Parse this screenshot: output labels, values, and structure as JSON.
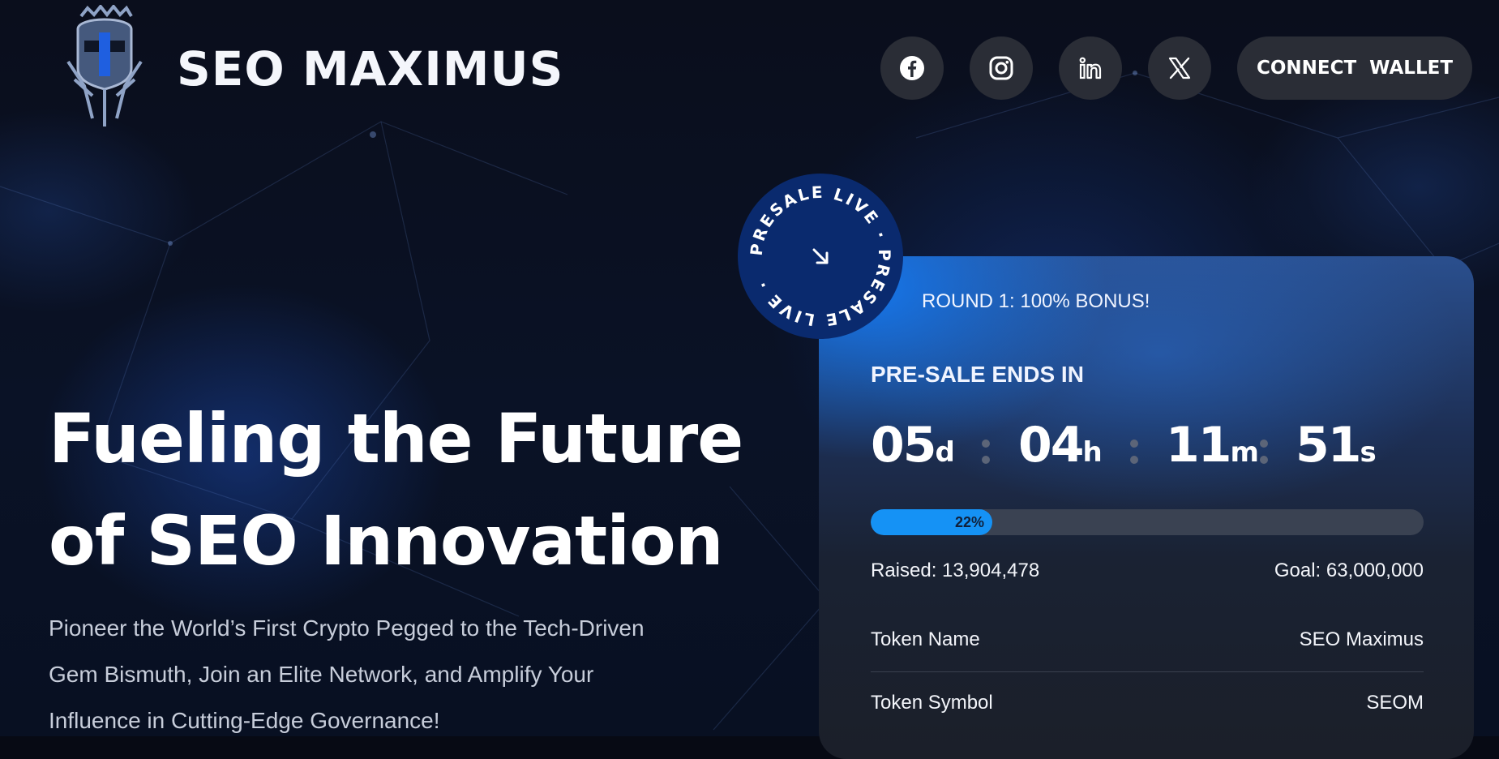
{
  "header": {
    "brand": "SEO MAXIMUS",
    "connect_label": "CONNECT WALLET",
    "social": [
      "facebook-icon",
      "instagram-icon",
      "linkedin-icon",
      "x-icon"
    ]
  },
  "hero": {
    "title_line1": "Fueling the Future",
    "title_line2": "of SEO Innovation",
    "sub_line1": "Pioneer the World’s First Crypto Pegged to the Tech-Driven",
    "sub_line2": "Gem Bismuth, Join an Elite Network, and Amplify Your",
    "sub_line3": "Influence in Cutting-Edge Governance!"
  },
  "badge": {
    "ring_text": "PRESALE LIVE · PRESALE LIVE · ",
    "icon": "arrow-down-right-icon"
  },
  "presale": {
    "round": "ROUND 1: 100% BONUS!",
    "ends_label": "PRE-SALE ENDS IN",
    "countdown": {
      "days": "05",
      "days_unit": "d",
      "hours": "04",
      "hours_unit": "h",
      "minutes": "11",
      "minutes_unit": "m",
      "seconds": "51",
      "seconds_unit": "s"
    },
    "progress_percent": 22,
    "progress_label": "22%",
    "raised": "Raised: 13,904,478",
    "goal": "Goal: 63,000,000",
    "details": [
      {
        "label": "Token Name",
        "value": "SEO Maximus"
      },
      {
        "label": "Token Symbol",
        "value": "SEOM"
      }
    ]
  },
  "colors": {
    "accent": "#1592f5",
    "badge": "#0a2a6e",
    "button_bg": "#2a2d36"
  }
}
